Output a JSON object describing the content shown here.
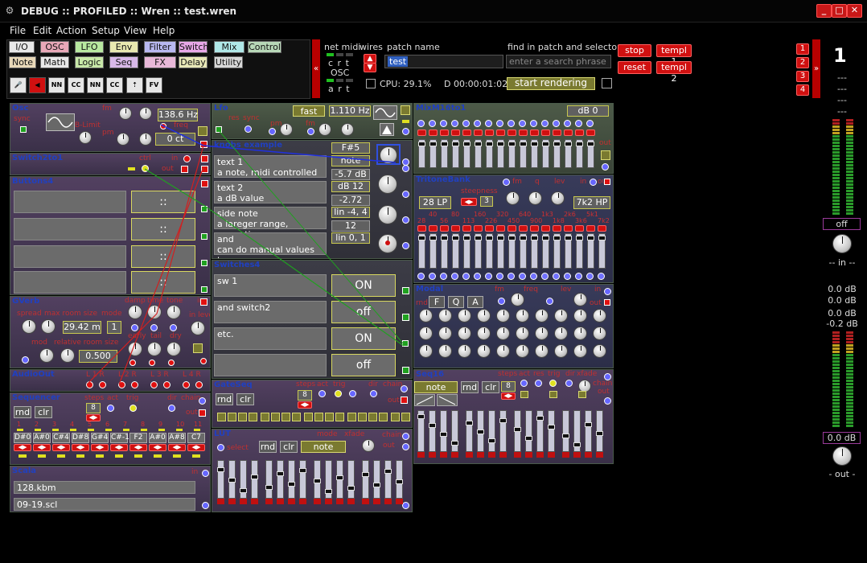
{
  "window": {
    "title": "DEBUG :: PROFILED :: Wren :: test.wren",
    "controls": [
      "_",
      "□",
      "✕"
    ]
  },
  "menu": [
    "File",
    "Edit",
    "Action",
    "Setup",
    "View",
    "Help"
  ],
  "tabs_row1": [
    {
      "label": "I/O",
      "color": "#e8e8e8"
    },
    {
      "label": "OSC",
      "color": "#e8a8b8"
    },
    {
      "label": "LFO",
      "color": "#b8e8a0"
    },
    {
      "label": "Env",
      "color": "#e8e8b0"
    },
    {
      "label": "Filter",
      "color": "#b8b8f0"
    },
    {
      "label": "Switch",
      "color": "#e8a8e8"
    },
    {
      "label": "Mix",
      "color": "#b0e8e8"
    },
    {
      "label": "Control",
      "color": "#b8d8b8"
    }
  ],
  "tabs_row2": [
    {
      "label": "Note",
      "color": "#e8d8b8"
    },
    {
      "label": "Math",
      "color": "#e8e8e8"
    },
    {
      "label": "Logic",
      "color": "#c8e8a8"
    },
    {
      "label": "Seq",
      "color": "#d8b8e8"
    },
    {
      "label": "FX",
      "color": "#e8b8d8"
    },
    {
      "label": "Delay",
      "color": "#e8e8b8"
    },
    {
      "label": "Utility",
      "color": "#d8d8d8"
    }
  ],
  "tools": [
    {
      "icon": "microphone-icon",
      "glyph": "🎤"
    },
    {
      "icon": "speaker-icon",
      "glyph": "◀"
    },
    {
      "icon": "note-nn-icon",
      "glyph": "NN"
    },
    {
      "icon": "cc-icon",
      "glyph": "CC"
    },
    {
      "icon": "note-nn-icon",
      "glyph": "NN"
    },
    {
      "icon": "cc-icon",
      "glyph": "CC"
    },
    {
      "icon": "arrow-up-icon",
      "glyph": "⇡"
    },
    {
      "icon": "fv-icon",
      "glyph": "FV"
    }
  ],
  "status": {
    "net_midi": "net midi",
    "wires": "wires",
    "crt": "c r t",
    "osc": "OSC",
    "art": "a r t",
    "patch_name_label": "patch name",
    "patch_name": "test",
    "find_label": "find in patch and selector",
    "find_placeholder": "enter a search phrase",
    "cpu": "CPU: 29.1%",
    "time": "D 00:00:01:02",
    "render": "start rendering",
    "stop": "stop",
    "reset": "reset",
    "templ1": "templ 1",
    "templ2": "templ 2"
  },
  "side_numbers": [
    "1",
    "2",
    "3",
    "4"
  ],
  "meters": {
    "big": "1",
    "dashes": [
      "---",
      "---",
      "---",
      "---"
    ],
    "off": "off",
    "in_label": "-- in --",
    "db1": "0.0 dB",
    "db2": "0.0 dB",
    "db3": "0.0 dB",
    "db4": "-0.2 dB",
    "out_db": "0.0 dB",
    "out_label": "- out -"
  },
  "modules": {
    "osc": {
      "title": "Osc",
      "sync": "sync",
      "fm": "fm",
      "blimit": "B-Limit",
      "pm": "pm",
      "freq_label": "freq",
      "freq": "138.6 Hz",
      "ct": "0 ct"
    },
    "switch2to1": {
      "title": "Switch2to1",
      "ctrl": "ctrl",
      "in": "in",
      "out": "out"
    },
    "buttons4": {
      "title": "Buttons4",
      "cells": [
        "::",
        "::",
        "::",
        "::"
      ]
    },
    "gverb": {
      "title": "GVerb",
      "spread": "spread",
      "maxroom": "max room size",
      "mode": "mode",
      "damp": "damp",
      "time": "time",
      "tone": "tone",
      "in": "in",
      "inlevel": "in level",
      "size": "29.42 m",
      "modeval": "1",
      "mod": "mod",
      "roomsize": "relative room size",
      "val": "0.500",
      "early": "early",
      "tail": "tail",
      "dry": "dry"
    },
    "audioout": {
      "title": "AudioOut",
      "channels": [
        "L 1 R",
        "L 2 R",
        "L 3 R",
        "L 4 R"
      ]
    },
    "sequencer": {
      "title": "Sequencer",
      "steps": "steps",
      "act": "act",
      "trig": "trig",
      "dir": "dir",
      "chain": "chain",
      "out": "out",
      "rnd": "rnd",
      "clr": "clr",
      "stepsval": "8",
      "nums": [
        "1",
        "2",
        "3",
        "4",
        "5",
        "6",
        "7",
        "8",
        "9",
        "10",
        "11"
      ],
      "notes": [
        "D#0",
        "A#0",
        "C#4",
        "D#8",
        "G#4",
        "C#-1",
        "F2",
        "A#0",
        "A#8",
        "C7"
      ]
    },
    "scala": {
      "title": "Scala",
      "in": "in",
      "kbm": "128.kbm",
      "scl": "09-19.scl"
    },
    "lfo": {
      "title": "Lfo",
      "fast": "fast",
      "freq": "1.110 Hz",
      "res": "res",
      "sync": "sync",
      "pm": "pm",
      "fm": "fm"
    },
    "knobs": {
      "title": "knobs example",
      "note": "F#5",
      "rows": [
        {
          "text1": "text 1",
          "text2": "a note, midi controlled",
          "btn": "note",
          "val": "-5.7 dB"
        },
        {
          "text1": "text 2",
          "text2": "a dB value",
          "btn": "dB 12",
          "val": "-2.72"
        },
        {
          "text1": "side note",
          "text2": "a lareger range, neagative",
          "btn": "lin -4, 4",
          "val": "12"
        },
        {
          "text1": "and",
          "text2": "can do manual values too",
          "btn": "lin 0, 1",
          "val": ""
        }
      ]
    },
    "switches4": {
      "title": "Switches4",
      "rows": [
        {
          "text": "sw 1",
          "state": "ON"
        },
        {
          "text": "and switch2",
          "state": "off"
        },
        {
          "text": "etc.",
          "state": "ON"
        },
        {
          "text": "",
          "state": "off"
        }
      ]
    },
    "gateseq": {
      "title": "GateSeq",
      "rnd": "rnd",
      "clr": "clr",
      "steps": "steps",
      "val": "8",
      "act": "act",
      "trig": "trig",
      "dir": "dir",
      "chain": "chain",
      "out": "out"
    },
    "lut": {
      "title": "LUT",
      "select": "select",
      "rnd": "rnd",
      "clr": "clr",
      "note": "note",
      "mode": "mode",
      "xfade": "xfade",
      "chain": "chain",
      "out": "out"
    },
    "mix": {
      "title": "MixM16to1",
      "db": "dB 0",
      "out": "out"
    },
    "tritone": {
      "title": "TritoneBank",
      "steepness": "steepness",
      "fm": "fm",
      "q": "q",
      "lev": "lev",
      "in": "in",
      "out": "out",
      "lp": "28 LP",
      "steep": "3",
      "hp": "7k2 HP",
      "freqs_top": [
        "40",
        "80",
        "160",
        "320",
        "640",
        "1k3",
        "2k6",
        "5k1"
      ],
      "freqs_bot": [
        "28",
        "56",
        "113",
        "226",
        "450",
        "900",
        "1k8",
        "3k6",
        "7k2"
      ]
    },
    "modal": {
      "title": "Modal",
      "fm": "fm",
      "freq": "freq",
      "lev": "lev",
      "in": "in",
      "out": "out",
      "rnd": "rnd",
      "f": "F",
      "q": "Q",
      "a": "A"
    },
    "seq16": {
      "title": "Seq16",
      "steps": "steps",
      "act": "act",
      "res": "res",
      "trig": "trig",
      "dir": "dir",
      "xfade": "xfade",
      "note": "note",
      "rnd": "rnd",
      "clr": "clr",
      "val": "8",
      "chain": "chain",
      "out": "out"
    }
  }
}
